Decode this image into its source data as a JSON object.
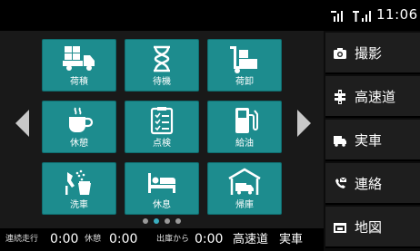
{
  "status": {
    "time": "11:06",
    "icons": [
      "sim-signal-icon",
      "cell-signal-icon"
    ]
  },
  "tiles": [
    {
      "label": "荷積",
      "icon": "truck-loading-icon"
    },
    {
      "label": "待機",
      "icon": "hourglass-icon"
    },
    {
      "label": "荷卸",
      "icon": "hand-truck-icon"
    },
    {
      "label": "休憩",
      "icon": "coffee-cup-icon"
    },
    {
      "label": "点検",
      "icon": "checklist-icon"
    },
    {
      "label": "給油",
      "icon": "fuel-pump-icon"
    },
    {
      "label": "洗車",
      "icon": "car-wash-icon"
    },
    {
      "label": "休息",
      "icon": "bed-icon"
    },
    {
      "label": "帰庫",
      "icon": "garage-icon"
    }
  ],
  "pager": {
    "count": 4,
    "active_index": 1
  },
  "side_menu": [
    {
      "label": "撮影",
      "icon": "camera-icon"
    },
    {
      "label": "高速道",
      "icon": "highway-icon"
    },
    {
      "label": "実車",
      "icon": "truck-icon"
    },
    {
      "label": "連絡",
      "icon": "phone-message-icon"
    },
    {
      "label": "地図",
      "icon": "map-icon"
    }
  ],
  "bottom_bar": {
    "continuous_drive_label": "連続走行",
    "continuous_drive_value": "0:00",
    "break_label": "休憩",
    "break_value": "0:00",
    "since_departure_label": "出庫から",
    "since_departure_value": "0:00",
    "highway_status": "高速道",
    "vehicle_status": "実車"
  },
  "colors": {
    "tile": "#1d8c8e",
    "side_item": "#1e1e1e",
    "pager_active": "#3aaec0"
  }
}
